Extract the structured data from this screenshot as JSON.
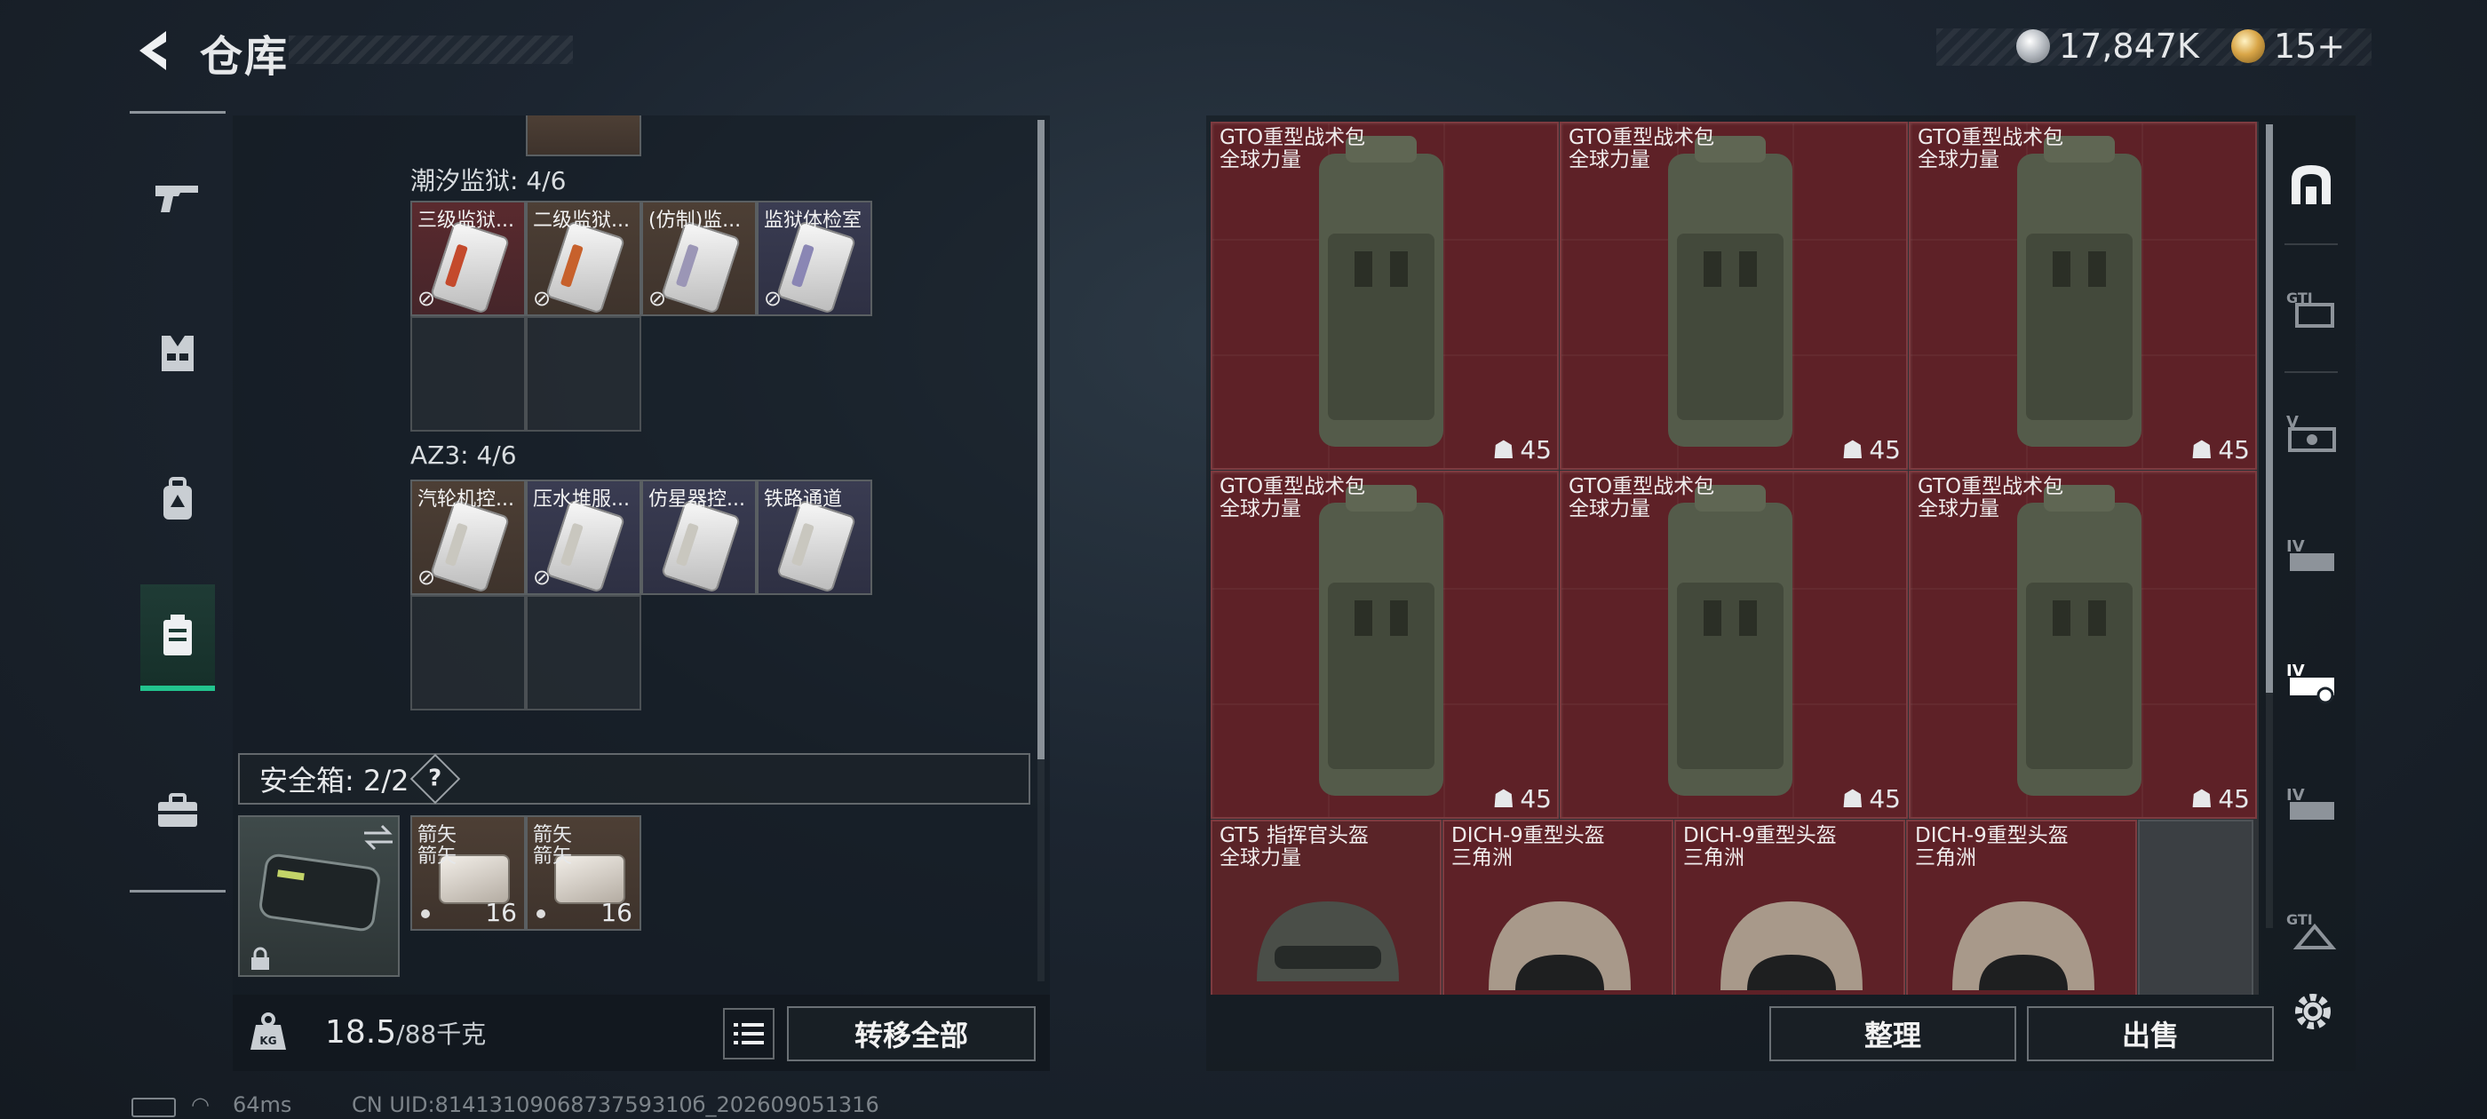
{
  "header": {
    "title": "仓库",
    "currency_main": "17,847K",
    "currency_secondary": "15+"
  },
  "left_nav": {
    "items": [
      {
        "icon": "gun-icon"
      },
      {
        "icon": "armor-vest-icon"
      },
      {
        "icon": "backpack-icon"
      },
      {
        "icon": "keycard-case-icon",
        "active": true
      },
      {
        "icon": "briefcase-icon"
      }
    ]
  },
  "storage": {
    "groups": [
      {
        "label": "潮汐监狱: 4/6",
        "items": [
          {
            "name": "三级监狱...",
            "color": "red",
            "stripe": "#c44a2c"
          },
          {
            "name": "二级监狱...",
            "color": "brown",
            "stripe": "#c7612c"
          },
          {
            "name": "(仿制)监...",
            "color": "brown",
            "stripe": "#9b96b6"
          },
          {
            "name": "监狱体检室",
            "color": "blue",
            "stripe": "#8a86b4"
          }
        ]
      },
      {
        "label": "AZ3: 4/6",
        "items": [
          {
            "name": "汽轮机控...",
            "color": "brown",
            "stripe": "#c9c7bf"
          },
          {
            "name": "压水堆服...",
            "color": "blue",
            "stripe": "#c9c7bf"
          },
          {
            "name": "仿星器控...",
            "color": "blue",
            "stripe": "#c9c7bf"
          },
          {
            "name": "铁路通道",
            "color": "blue",
            "stripe": "#c9c7bf"
          }
        ]
      }
    ],
    "safe_box": {
      "label": "安全箱: 2/2",
      "help": "?",
      "items": [
        {
          "name": "箭矢",
          "sub": "箭矢",
          "count": "16"
        },
        {
          "name": "箭矢",
          "sub": "箭矢",
          "count": "16"
        }
      ]
    },
    "weight": {
      "current": "18.5",
      "max": "/88千克"
    },
    "transfer_all": "转移全部"
  },
  "grid": {
    "backpacks": [
      {
        "name": "GTO重型战术包",
        "sub": "全球力量",
        "durability": "45"
      },
      {
        "name": "GTO重型战术包",
        "sub": "全球力量",
        "durability": "45"
      },
      {
        "name": "GTO重型战术包",
        "sub": "全球力量",
        "durability": "45"
      },
      {
        "name": "GTO重型战术包",
        "sub": "全球力量",
        "durability": "45"
      },
      {
        "name": "GTO重型战术包",
        "sub": "全球力量",
        "durability": "45"
      },
      {
        "name": "GTO重型战术包",
        "sub": "全球力量",
        "durability": "45"
      }
    ],
    "helmets": [
      {
        "name": "GT5 指挥官头盔",
        "sub": "全球力量"
      },
      {
        "name": "DICH-9重型头盔",
        "sub": "三角洲"
      },
      {
        "name": "DICH-9重型头盔",
        "sub": "三角洲"
      },
      {
        "name": "DICH-9重型头盔",
        "sub": "三角洲"
      }
    ],
    "sort_label": "整理",
    "sell_label": "出售"
  },
  "right_nav": {
    "items": [
      "locker-arch-icon",
      "gti-tier-icon",
      "v-tier-icon",
      "iv-tier-icon",
      "iv-tier-active-icon",
      "iv-tier-icon",
      "gti-tier-icon-2"
    ]
  },
  "footer": {
    "ping": "64ms",
    "uid": "CN UID:8141310906873759310б_202609051316"
  }
}
